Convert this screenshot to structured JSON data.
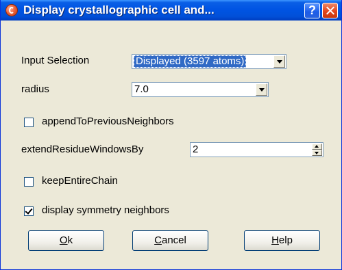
{
  "window": {
    "title": "Display crystallographic cell and...",
    "help_glyph": "?",
    "icon": "app-icon"
  },
  "form": {
    "input_selection": {
      "label": "Input Selection",
      "value": "Displayed (3597 atoms)"
    },
    "radius": {
      "label": "radius",
      "value": "7.0"
    },
    "append_to_previous": {
      "label": "appendToPreviousNeighbors",
      "checked": false
    },
    "extend_residue": {
      "label": "extendResidueWindowsBy",
      "value": "2"
    },
    "keep_entire_chain": {
      "label": "keepEntireChain",
      "checked": false
    },
    "display_symmetry": {
      "label": "display symmetry neighbors",
      "checked": true
    }
  },
  "buttons": {
    "ok": {
      "first": "O",
      "rest": "k"
    },
    "cancel": {
      "first": "C",
      "rest": "ancel"
    },
    "help": {
      "first": "H",
      "rest": "elp"
    }
  }
}
